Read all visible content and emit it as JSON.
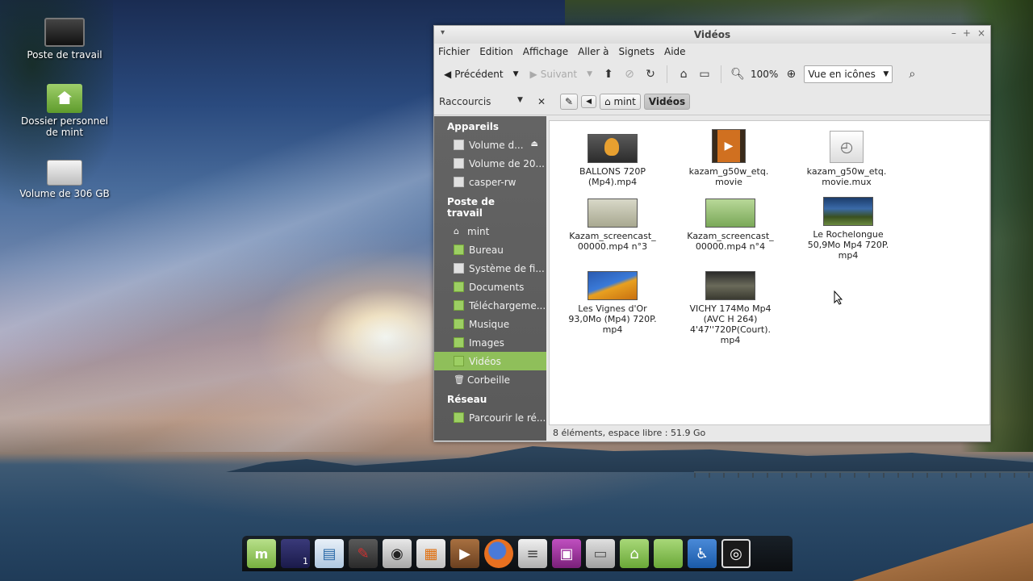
{
  "desktop": {
    "icons": [
      {
        "label": "Poste de travail",
        "icon": "monitor-icon"
      },
      {
        "label": "Dossier personnel de mint",
        "icon": "home-folder-icon"
      },
      {
        "label": "Volume de 306 GB",
        "icon": "drive-icon"
      }
    ]
  },
  "window": {
    "title": "Vidéos",
    "menu": [
      "Fichier",
      "Edition",
      "Affichage",
      "Aller à",
      "Signets",
      "Aide"
    ],
    "toolbar": {
      "back_label": "Précédent",
      "forward_label": "Suivant",
      "zoom_level": "100%",
      "view_mode": "Vue en icônes"
    },
    "sidebar_header": "Raccourcis",
    "breadcrumbs": [
      "mint",
      "Vidéos"
    ],
    "sidebar": {
      "sections": [
        {
          "title": "Appareils",
          "items": [
            "Volume d...",
            "Volume de 20...",
            "casper-rw"
          ]
        },
        {
          "title": "Poste de travail",
          "items": [
            "mint",
            "Bureau",
            "Système de fi...",
            "Documents",
            "Téléchargeme...",
            "Musique",
            "Images",
            "Vidéos",
            "Corbeille"
          ]
        },
        {
          "title": "Réseau",
          "items": [
            "Parcourir le ré..."
          ]
        }
      ]
    },
    "files": [
      {
        "name": "BALLONS       720P (Mp4).mp4"
      },
      {
        "name": "kazam_g50w_etq. movie"
      },
      {
        "name": "kazam_g50w_etq. movie.mux"
      },
      {
        "name": "Kazam_screencast_ 00000.mp4 n°3"
      },
      {
        "name": "Kazam_screencast_ 00000.mp4 n°4"
      },
      {
        "name": "Le Rochelongue 50,9Mo Mp4 720P. mp4"
      },
      {
        "name": "Les Vignes d'Or 93,0Mo (Mp4)  720P. mp4"
      },
      {
        "name": "VICHY 174Mo Mp4 (AVC H 264) 4'47''720P(Court). mp4"
      }
    ],
    "status": "8 éléments, espace libre : 51.9 Go"
  },
  "dock": {
    "items": [
      "mint-menu-icon",
      "workspace-icon",
      "writer-icon",
      "text-editor-icon",
      "camera-icon",
      "video-editor-icon",
      "media-player-icon",
      "firefox-icon",
      "mixer-icon",
      "media-icon",
      "files-icon",
      "home-folder-icon",
      "folder-icon",
      "accessibility-icon",
      "settings-icon"
    ],
    "workspace_label": "1"
  }
}
